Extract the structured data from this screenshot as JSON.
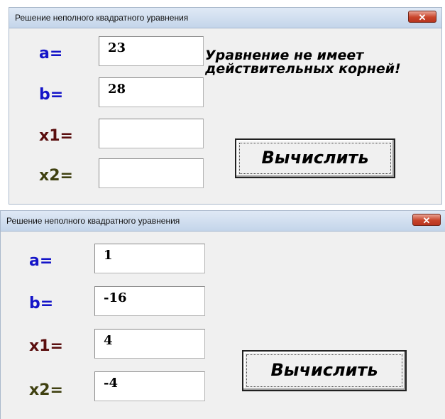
{
  "windows": [
    {
      "title": "Решение неполного квадратного уравнения",
      "close_symbol": "✕",
      "labels": {
        "a": "a=",
        "b": "b=",
        "x1": "x1=",
        "x2": "x2="
      },
      "values": {
        "a": "23",
        "b": "28",
        "x1": "",
        "x2": ""
      },
      "message": "Уравнение не имеет действительных корней!",
      "button_label": "Вычислить"
    },
    {
      "title": "Решение неполного квадратного уравнения",
      "close_symbol": "✕",
      "labels": {
        "a": "a=",
        "b": "b=",
        "x1": "x1=",
        "x2": "x2="
      },
      "values": {
        "a": "1",
        "b": "-16",
        "x1": "4",
        "x2": "-4"
      },
      "message": "",
      "button_label": "Вычислить"
    }
  ],
  "colors": {
    "label_ab": "#1414c8",
    "label_x1": "#5a0e0e",
    "label_x2": "#3f4010"
  },
  "icons": {
    "close": "close-icon"
  }
}
